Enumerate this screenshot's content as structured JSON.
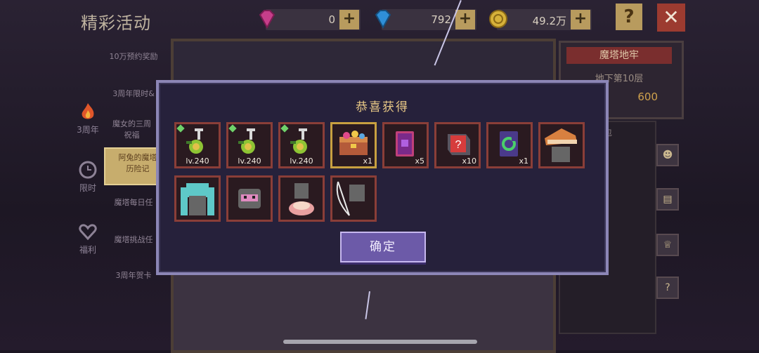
{
  "page_title": "精彩活动",
  "currencies": [
    {
      "icon": "pink-gem-icon",
      "amount": "0",
      "color": "#c63e8a"
    },
    {
      "icon": "blue-gem-icon",
      "amount": "792",
      "color": "#2f8fd8"
    },
    {
      "icon": "gold-coin-icon",
      "amount": "49.2万",
      "color": "#d7b23a"
    }
  ],
  "plus_symbol": "+",
  "help_symbol": "?",
  "close_symbol": "✕",
  "sidebar": {
    "items": [
      {
        "label": "10万预约奖励"
      },
      {
        "label": "3周年限时&"
      },
      {
        "label": "魔女的三周\n祝福"
      },
      {
        "label": "阿兔的魔塔\n历险记"
      },
      {
        "label": "魔塔每日任"
      },
      {
        "label": "魔塔挑战任"
      },
      {
        "label": "3周年贺卡"
      }
    ],
    "categories": [
      {
        "label": "3周年",
        "icon": "flame-icon"
      },
      {
        "label": "限时",
        "icon": "clock-icon"
      },
      {
        "label": "福利",
        "icon": "heart-icon"
      }
    ]
  },
  "tower_panel": {
    "title": "魔塔地牢",
    "floor": "地下第10层",
    "value": "600"
  },
  "bag_label": "背包",
  "dialog": {
    "title": "恭喜获得",
    "confirm_label": "确定",
    "items": [
      {
        "name": "green-key-potion",
        "level": "lv.240",
        "qty": "",
        "new": true
      },
      {
        "name": "green-key-potion",
        "level": "lv.240",
        "qty": "",
        "new": true
      },
      {
        "name": "green-key-potion",
        "level": "lv.240",
        "qty": "",
        "new": true
      },
      {
        "name": "treasure-chest",
        "level": "",
        "qty": "x1",
        "new": false
      },
      {
        "name": "purple-monster-card",
        "level": "",
        "qty": "x5",
        "new": false
      },
      {
        "name": "red-question-block",
        "level": "",
        "qty": "x10",
        "new": false
      },
      {
        "name": "green-refresh-card",
        "level": "",
        "qty": "x1",
        "new": false
      },
      {
        "name": "orange-hat",
        "level": "",
        "qty": "",
        "new": false
      },
      {
        "name": "cyan-twintail-hair",
        "level": "",
        "qty": "",
        "new": false
      },
      {
        "name": "pink-mask",
        "level": "",
        "qty": "",
        "new": false
      },
      {
        "name": "pink-skirt",
        "level": "",
        "qty": "",
        "new": false
      },
      {
        "name": "bow-weapon",
        "level": "",
        "qty": "",
        "new": false
      }
    ]
  }
}
